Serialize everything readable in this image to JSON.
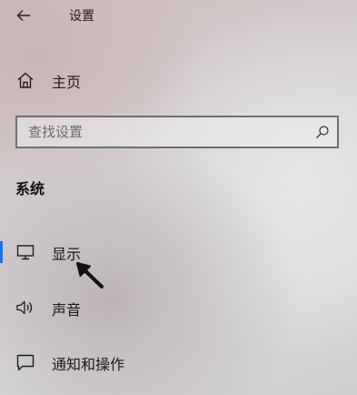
{
  "window": {
    "title": "设置"
  },
  "nav": {
    "home_label": "主页",
    "search": {
      "placeholder": "查找设置",
      "value": ""
    },
    "section_title": "系统",
    "items": [
      {
        "label": "显示",
        "icon": "monitor-icon",
        "selected": true
      },
      {
        "label": "声音",
        "icon": "speaker-icon",
        "selected": false
      },
      {
        "label": "通知和操作",
        "icon": "notification-icon",
        "selected": false
      }
    ]
  },
  "colors": {
    "accent": "#1a73e8"
  },
  "annotation": {
    "icon": "arrow-pointer-icon"
  }
}
